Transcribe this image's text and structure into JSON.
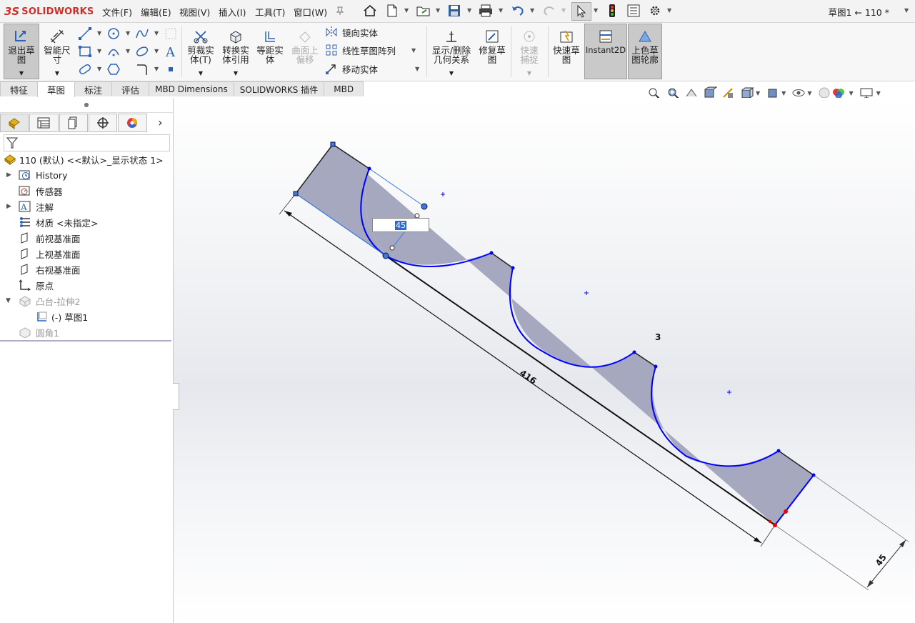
{
  "app": {
    "brand_ds": "3S",
    "brand_name": "SOLIDWORKS",
    "doc_title": "草图1 ← 110 *"
  },
  "menu": [
    "文件(F)",
    "编辑(E)",
    "视图(V)",
    "插入(I)",
    "工具(T)",
    "窗口(W)"
  ],
  "ribbon": {
    "exit_sketch": "退出草图",
    "smart_dim": "智能尺寸",
    "trim": "剪裁实体(T)",
    "convert": "转换实体引用",
    "offset": "等距实体",
    "surface_offset": "曲面上偏移",
    "mirror": "镜向实体",
    "linear_pattern": "线性草图阵列",
    "move": "移动实体",
    "display_relations": "显示/删除几何关系",
    "repair": "修复草图",
    "quick_snap": "快速捕捉",
    "rapid_sketch": "快速草图",
    "instant2d": "Instant2D",
    "shaded_contours": "上色草图轮廓"
  },
  "tabs": [
    "特征",
    "草图",
    "标注",
    "评估",
    "MBD Dimensions",
    "SOLIDWORKS 插件",
    "MBD"
  ],
  "active_tab": "草图",
  "tree": {
    "root": "110 (默认) <<默认>_显示状态 1>",
    "items": [
      "History",
      "传感器",
      "注解",
      "材质 <未指定>",
      "前视基准面",
      "上视基准面",
      "右视基准面",
      "原点",
      "凸台-拉伸2",
      "(-) 草图1",
      "圆角1"
    ]
  },
  "sketch": {
    "dim_input_value": "45",
    "dim_length": "416",
    "dim_width": "45",
    "note": "3",
    "accent_color": "#0000ff",
    "fill_color": "#a6a8c0"
  }
}
